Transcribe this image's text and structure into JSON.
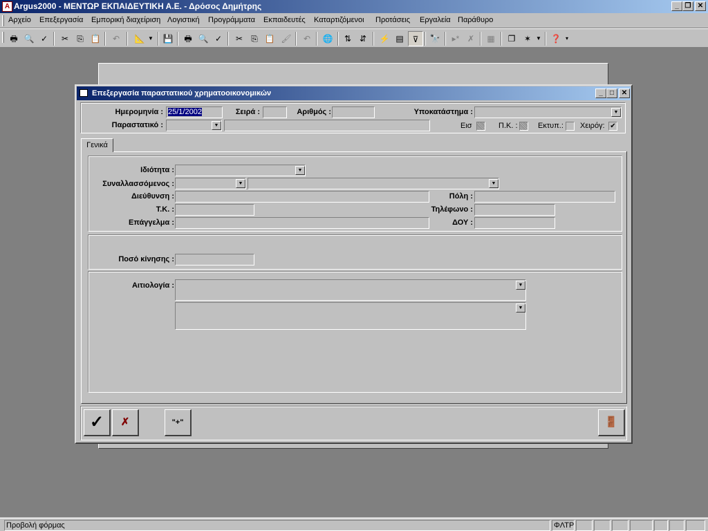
{
  "app": {
    "title": "Argus2000 - ΜΕΝΤΩΡ ΕΚΠΑΙΔΕΥΤΙΚΗ Α.Ε. - Δρόσος Δημήτρης"
  },
  "menu": [
    "Αρχείο",
    "Επεξεργασία",
    "Εμπορική διαχείριση",
    "Λογιστική",
    "Προγράμματα",
    "Εκπαιδευτές",
    "Καταρτιζόμενοι",
    "Προτάσεις",
    "Εργαλεία",
    "Παράθυρο"
  ],
  "dialog": {
    "title": "Επεξεργασία παραστατικού χρηματοοικονομικών",
    "header": {
      "date_label": "Ημερομηνία :",
      "date_value": "25/1/2002",
      "series_label": "Σειρά :",
      "series_value": "",
      "number_label": "Αριθμός :",
      "number_value": "",
      "branch_label": "Υποκατάστημα :",
      "branch_value": "",
      "document_label": "Παραστατικό :",
      "document_value": "",
      "document_desc": "",
      "eis_label": "Εισ",
      "pk_label": "Π.Κ. :",
      "print_label": "Εκτυπ.:",
      "manual_label": "Χειρόγ:"
    },
    "tab_label": "Γενικά",
    "party": {
      "property_label": "Ιδιότητα :",
      "counterparty_label": "Συναλλασσόμενος :",
      "address_label": "Διεύθυνση :",
      "city_label": "Πόλη :",
      "zip_label": "Τ.Κ. :",
      "phone_label": "Τηλέφωνο :",
      "job_label": "Επάγγελμα :",
      "doy_label": "ΔΟΥ :"
    },
    "amount_label": "Ποσό κίνησης :",
    "reason_label": "Αιτιολογία :",
    "buttons": {
      "add_label": "\"+\""
    }
  },
  "status": {
    "text": "Προβολή φόρμας",
    "filter": "ΦΛΤΡ"
  },
  "colors": {
    "title_start": "#0a246a",
    "title_end": "#a6caf0",
    "workspace": "#808080",
    "face": "#c0c0c0"
  }
}
